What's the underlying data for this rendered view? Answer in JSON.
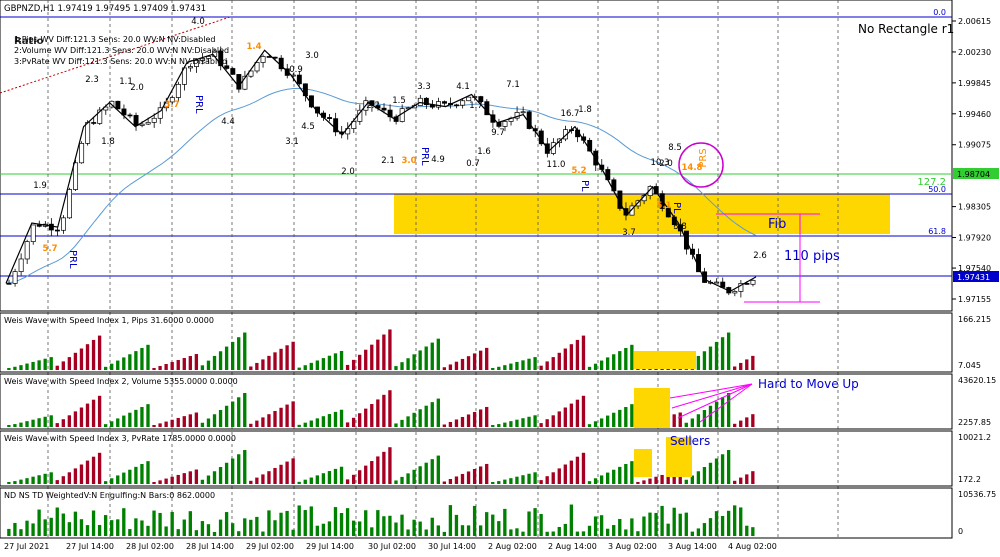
{
  "header": {
    "symbol_line": "GBPNZD,H1  1.97419 1.97495 1.97409 1.97431",
    "indicator_lines": [
      "1:Pips WV Diff:121.3 Sens: 20.0 WV:N NV:Disabled",
      "2:Volume WV Diff:121.3 Sens: 20.0 WV:N NV:Disabled",
      "3:PvRate WV Diff:121.3 Sens: 20.0 WV:N NV:Disabled"
    ],
    "ratio_label": "Ratio",
    "rectangle_label": "No Rectangle r1"
  },
  "main": {
    "price_labels": [
      "2.00615",
      "2.00230",
      "1.99845",
      "1.99460",
      "1.99075",
      "1.98704",
      "1.98305",
      "1.97920",
      "1.97540",
      "1.97431",
      "1.97155"
    ],
    "current_price": "1.97431",
    "green_price": "1.98704",
    "fib_levels": {
      "zero": "0.0",
      "fifty": "50.0",
      "sixtyone": "61.8",
      "onetwenty": "127.2"
    },
    "annotations": {
      "fib": "Fib",
      "pips": "110 pips",
      "prs": "PRS"
    },
    "wave_labels": [
      {
        "t": "4.0",
        "c": "#000000"
      },
      {
        "t": "1.4",
        "c": "#ff8c00"
      },
      {
        "t": "3.0",
        "c": "#000000"
      },
      {
        "t": "0.9",
        "c": "#000000"
      },
      {
        "t": "2.3",
        "c": "#000000"
      },
      {
        "t": "1.1",
        "c": "#000000"
      },
      {
        "t": "2.0",
        "c": "#000000"
      },
      {
        "t": "3.7",
        "c": "#ff8c00"
      },
      {
        "t": "4.4",
        "c": "#000000"
      },
      {
        "t": "3.1",
        "c": "#000000"
      },
      {
        "t": "4.5",
        "c": "#000000"
      },
      {
        "t": "2.0",
        "c": "#000000"
      },
      {
        "t": "1.8",
        "c": "#000000"
      },
      {
        "t": "1.9",
        "c": "#000000"
      },
      {
        "t": "5.7",
        "c": "#ff8c00"
      },
      {
        "t": "2.2",
        "c": "#000000"
      },
      {
        "t": "1.5",
        "c": "#000000"
      },
      {
        "t": "3.3",
        "c": "#000000"
      },
      {
        "t": "4.1",
        "c": "#000000"
      },
      {
        "t": "1.7",
        "c": "#000000"
      },
      {
        "t": "7.1",
        "c": "#000000"
      },
      {
        "t": "9.7",
        "c": "#000000"
      },
      {
        "t": "16.7",
        "c": "#000000"
      },
      {
        "t": "1.8",
        "c": "#000000"
      },
      {
        "t": "2.1",
        "c": "#000000"
      },
      {
        "t": "3.0",
        "c": "#ff8c00"
      },
      {
        "t": "4.9",
        "c": "#000000"
      },
      {
        "t": "0.7",
        "c": "#000000"
      },
      {
        "t": "1.6",
        "c": "#000000"
      },
      {
        "t": "11.0",
        "c": "#000000"
      },
      {
        "t": "2.0",
        "c": "#000000"
      },
      {
        "t": "5.2",
        "c": "#ff8c00"
      },
      {
        "t": "8.5",
        "c": "#000000"
      },
      {
        "t": "10.3",
        "c": "#000000"
      },
      {
        "t": "14.8",
        "c": "#ff8c00"
      },
      {
        "t": "5.1",
        "c": "#ff8c00"
      },
      {
        "t": "3.7",
        "c": "#000000"
      },
      {
        "t": "3.8",
        "c": "#000000"
      },
      {
        "t": "2.6",
        "c": "#000000"
      }
    ],
    "vertical_texts": [
      "PRL",
      "PRL",
      "PRL",
      "PL",
      "PL"
    ]
  },
  "panels": [
    {
      "title": "Weis Wave with Speed Index 1, Pips   31.6000 0.0000",
      "scale": [
        "166.215",
        "7.045"
      ]
    },
    {
      "title": "Weis Wave with Speed Index 2, Volume 5355.0000 0.0000",
      "scale": [
        "43620.15",
        "2257.85"
      ],
      "annotation": "Hard to Move Up"
    },
    {
      "title": "Weis Wave with Speed Index 3, PvRate 1785.0000 0.0000",
      "scale": [
        "10021.2",
        "172.2"
      ],
      "annotation": "Sellers"
    },
    {
      "title": "ND NS TD WeightedV:N Engulfing:N Bars:0   862.0000",
      "scale": [
        "10536.75",
        "0"
      ]
    }
  ],
  "x_axis": [
    "27 Jul 2021",
    "27 Jul 14:00",
    "28 Jul 02:00",
    "28 Jul 14:00",
    "29 Jul 02:00",
    "29 Jul 14:00",
    "30 Jul 02:00",
    "30 Jul 14:00",
    "2 Aug 02:00",
    "2 Aug 14:00",
    "3 Aug 02:00",
    "3 Aug 14:00",
    "4 Aug 02:00"
  ],
  "colors": {
    "bull": "#008000",
    "bear": "#a50021",
    "ma": "#5b9bd5",
    "zone": "#ffd700",
    "fib": "#0000cd",
    "accent": "#ff00ff"
  },
  "chart_data": {
    "type": "candlestick",
    "title": "GBPNZD,H1",
    "ylim": [
      1.97,
      2.007
    ],
    "zigzag_close_approx": [
      1.9735,
      1.981,
      1.9805,
      1.993,
      1.996,
      1.993,
      1.995,
      2.001,
      2.002,
      1.998,
      2.0025,
      1.9995,
      1.995,
      1.992,
      1.996,
      1.994,
      1.996,
      1.9955,
      1.997,
      1.9935,
      1.9945,
      1.99,
      1.993,
      1.988,
      1.982,
      1.9855,
      1.981,
      1.974,
      1.9725,
      1.9743
    ],
    "series": [
      {
        "name": "Pips",
        "values_scale": [
          0,
          166.215
        ]
      },
      {
        "name": "Volume",
        "values_scale": [
          0,
          43620.15
        ]
      },
      {
        "name": "PvRate",
        "values_scale": [
          0,
          10021.2
        ]
      },
      {
        "name": "WeightedV",
        "values_scale": [
          0,
          10536.75
        ]
      }
    ]
  }
}
